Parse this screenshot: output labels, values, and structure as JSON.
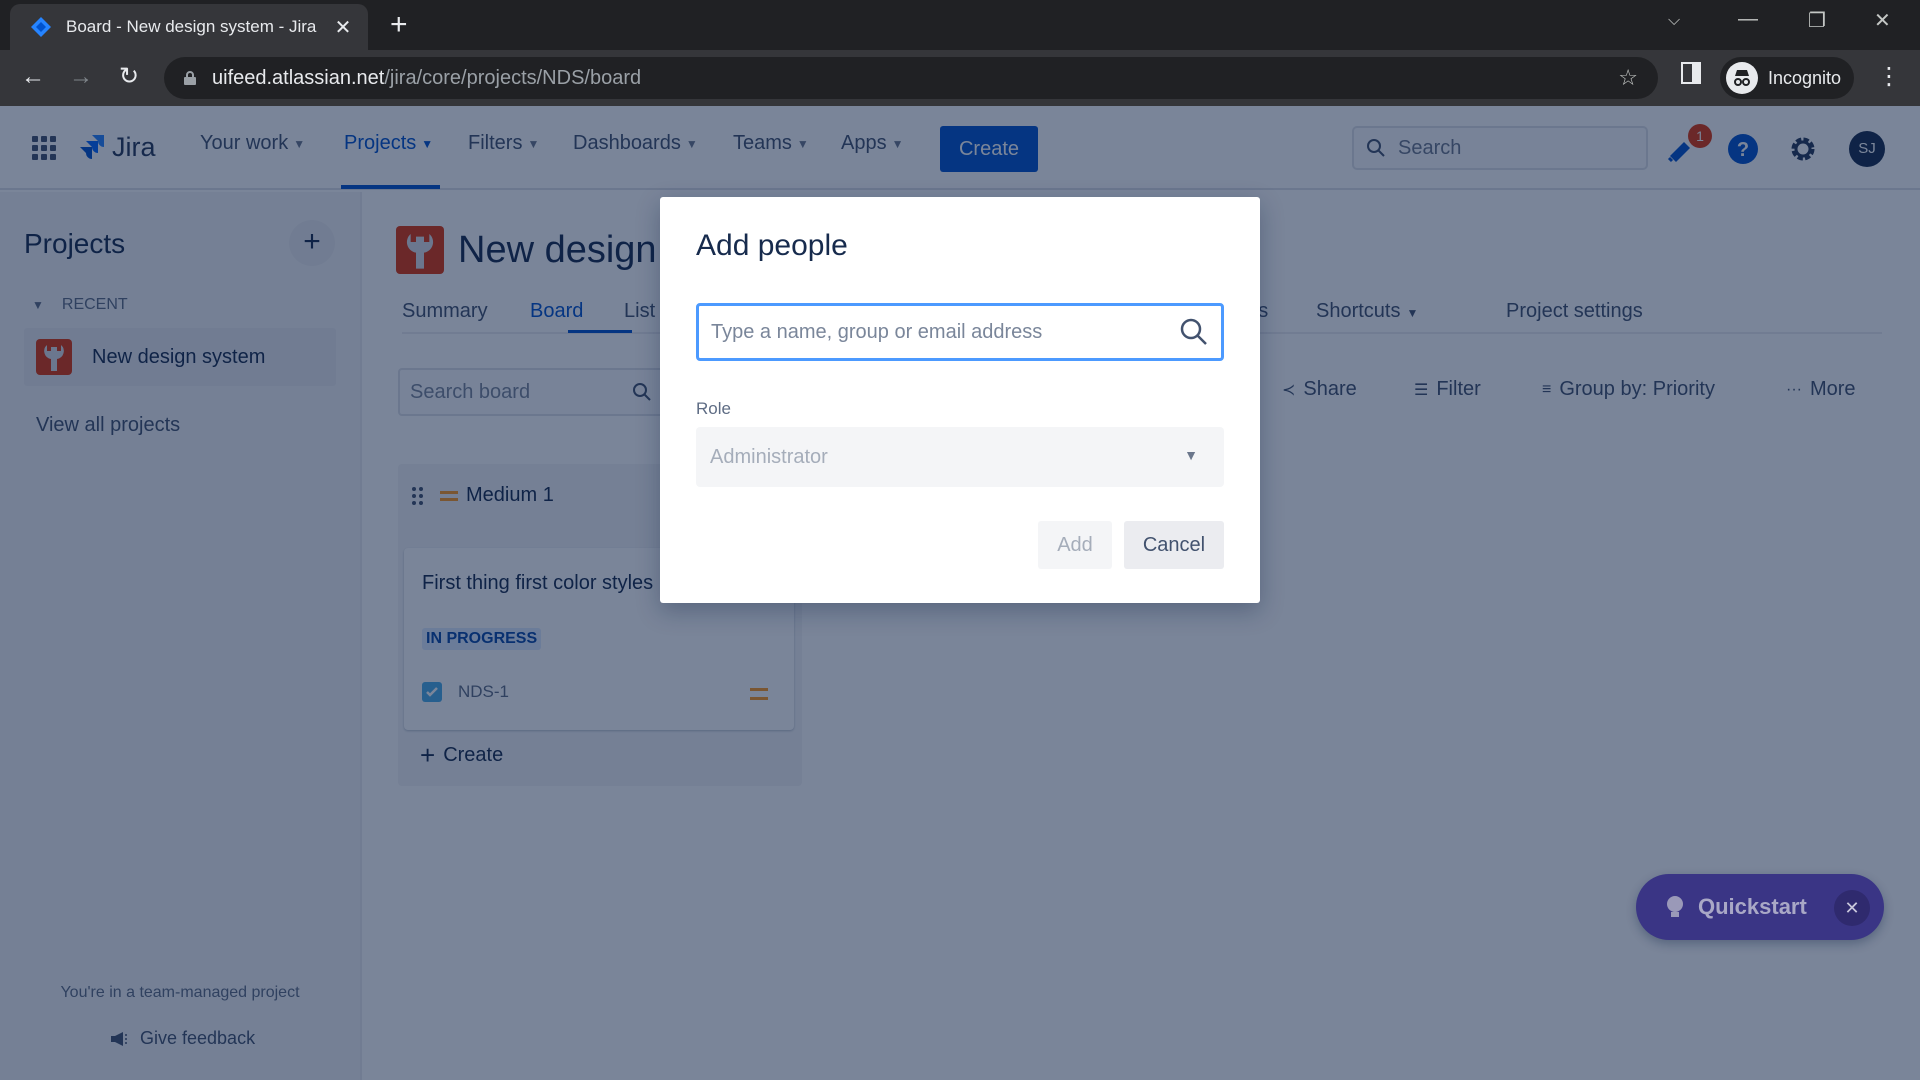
{
  "browser": {
    "tab_title": "Board - New design system - Jira",
    "url_host": "uifeed.atlassian.net",
    "url_path": "/jira/core/projects/NDS/board",
    "profile_label": "Incognito"
  },
  "topnav": {
    "product": "Jira",
    "menu": [
      {
        "label": "Your work",
        "active": false
      },
      {
        "label": "Projects",
        "active": true
      },
      {
        "label": "Filters",
        "active": false
      },
      {
        "label": "Dashboards",
        "active": false
      },
      {
        "label": "Teams",
        "active": false
      },
      {
        "label": "Apps",
        "active": false
      }
    ],
    "create_label": "Create",
    "search_placeholder": "Search",
    "notification_count": "1",
    "avatar_initials": "SJ"
  },
  "sidebar": {
    "title": "Projects",
    "recent_label": "RECENT",
    "project_name": "New design system",
    "view_all": "View all projects",
    "footer_note": "You're in a team-managed project",
    "feedback_label": "Give feedback"
  },
  "project": {
    "title": "New design",
    "tabs": [
      "Summary",
      "Board",
      "List",
      "rts",
      "Shortcuts",
      "Project settings"
    ],
    "active_tab": "Board",
    "search_placeholder": "Search board",
    "toolbar": {
      "share": "Share",
      "filter": "Filter",
      "group_by": "Group by: Priority",
      "more": "More"
    }
  },
  "board": {
    "column": {
      "title": "Medium 1",
      "cards": [
        {
          "title": "First thing first color styles",
          "status": "IN PROGRESS",
          "key": "NDS-1",
          "priority": "Medium"
        }
      ],
      "create_label": "Create"
    }
  },
  "quickstart": {
    "label": "Quickstart"
  },
  "modal": {
    "title": "Add people",
    "input_placeholder": "Type a name, group or email address",
    "input_value": "",
    "role_label": "Role",
    "role_value": "Administrator",
    "add_label": "Add",
    "cancel_label": "Cancel"
  },
  "colors": {
    "brand": "#0052cc",
    "danger": "#de350b",
    "priority_medium": "#ff991f",
    "quickstart": "#5243aa"
  }
}
